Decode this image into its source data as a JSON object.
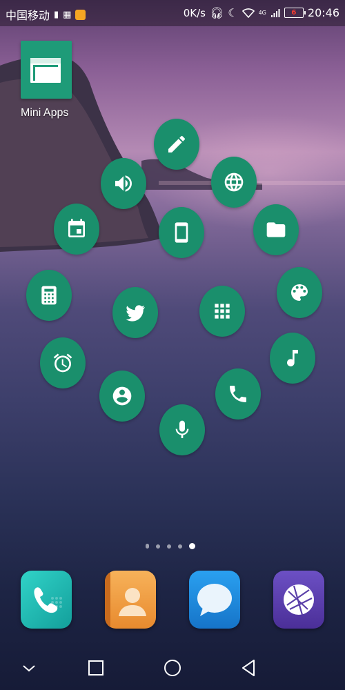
{
  "status_bar": {
    "carrier": "中国移动",
    "net_speed": "0K/s",
    "network_type": "4G",
    "battery": "6",
    "time": "20:46"
  },
  "home": {
    "mini_apps": {
      "label": "Mini Apps",
      "icon": "window-icon"
    },
    "bubbles": [
      {
        "icon": "pencil-icon"
      },
      {
        "icon": "volume-icon"
      },
      {
        "icon": "globe-icon"
      },
      {
        "icon": "calendar-icon"
      },
      {
        "icon": "smartphone-icon"
      },
      {
        "icon": "folder-icon"
      },
      {
        "icon": "calculator-icon"
      },
      {
        "icon": "twitter-icon"
      },
      {
        "icon": "apps-grid-icon"
      },
      {
        "icon": "palette-icon"
      },
      {
        "icon": "alarm-icon"
      },
      {
        "icon": "music-note-icon"
      },
      {
        "icon": "contact-icon"
      },
      {
        "icon": "phone-icon"
      },
      {
        "icon": "microphone-icon"
      }
    ],
    "page_indicator": {
      "pages": 5,
      "current": 5
    }
  },
  "dock": [
    {
      "icon": "phone-app-icon",
      "color": "#1fb8b0"
    },
    {
      "icon": "contacts-app-icon",
      "color": "#f0a04a"
    },
    {
      "icon": "messages-app-icon",
      "color": "#1f8fe0"
    },
    {
      "icon": "browser-app-icon",
      "color": "#5a3fa8"
    }
  ],
  "nav_bar": [
    "chevron-down-icon",
    "square-icon",
    "circle-icon",
    "back-triangle-icon"
  ],
  "colors": {
    "bubble": "#1a8f6c",
    "mini_app": "#1e9b78"
  }
}
